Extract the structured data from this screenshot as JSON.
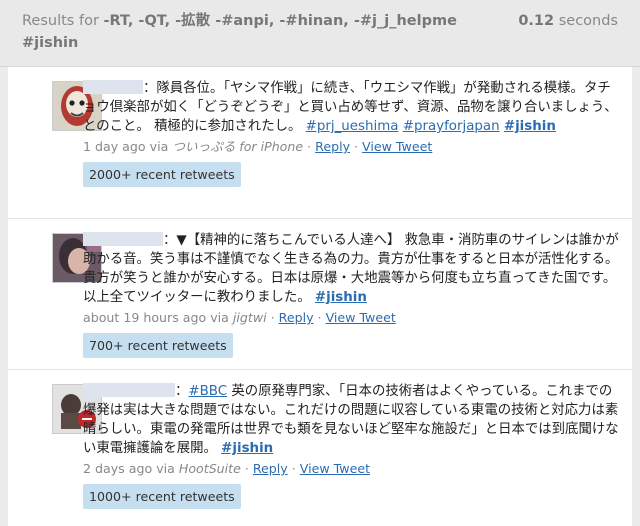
{
  "header": {
    "results_for_label": "Results for",
    "query": "-RT, -QT, -拡散 -#anpi, -#hinan, -#j_j_helpme #jishin",
    "time_value": "0.12",
    "time_unit": "seconds"
  },
  "tweets": [
    {
      "text": "：隊員各位。「ヤシマ作戦」に続き、「ウエシマ作戦」が発動される模様。タチョウ倶楽部が如く「どうぞどうぞ」と買い占め等せず、資源、品物を譲り合いましょう、とのこと。 積極的に参加されたし。",
      "tags": [
        "#prj_ueshima",
        "#prayforjapan",
        "#jishin"
      ],
      "time": "1 day ago",
      "via": "via",
      "source": "ついっぷる for iPhone",
      "reply": "Reply",
      "view": "View Tweet",
      "retweets": "2000+ recent retweets"
    },
    {
      "text": "：▼【精神的に落ちこんでいる人達へ】 救急車・消防車のサイレンは誰かが助かる音。笑う事は不謹慎でなく生きる為の力。貴方が仕事をすると日本が活性化する。貴方が笑うと誰かが安心する。日本は原爆・大地震等から何度も立ち直ってきた国です。以上全てツイッターに教わりました。",
      "tags": [
        "#jishin"
      ],
      "time": "about 19 hours ago",
      "via": "via",
      "source": "jigtwi",
      "reply": "Reply",
      "view": "View Tweet",
      "retweets": "700+ recent retweets"
    },
    {
      "prefix_tag": "#BBC",
      "text": " 英の原発専門家、「日本の技術者はよくやっている。これまでの爆発は実は大きな問題ではない。これだけの問題に収容している東電の技術と対応力は素晴らしい。東電の発電所は世界でも類を見ないほど堅牢な施設だ」と日本では到底聞けない東電擁護論を展開。",
      "tags": [
        "#jishin"
      ],
      "time": "2 days ago",
      "via": "via",
      "source": "HootSuite",
      "reply": "Reply",
      "view": "View Tweet",
      "retweets": "1000+ recent retweets"
    }
  ]
}
